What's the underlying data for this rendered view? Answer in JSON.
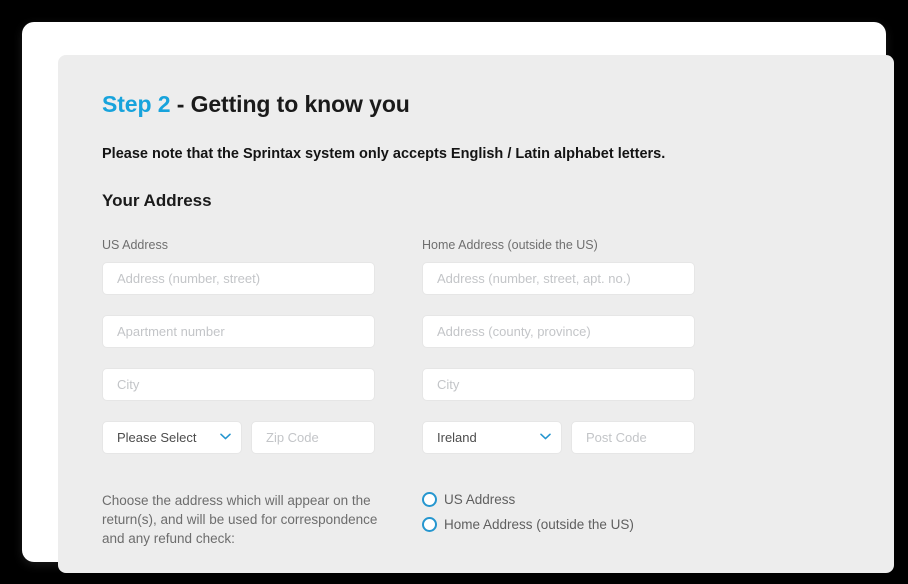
{
  "colors": {
    "accent": "#17a3dc",
    "radio_ring": "#2596cf",
    "panel_bg": "#ededed",
    "frame_bg": "#ffffff",
    "page_bg": "#000000"
  },
  "heading": {
    "step": "Step 2",
    "rest": " - Getting to know you"
  },
  "notice": "Please note that the Sprintax system only accepts English / Latin alphabet letters.",
  "section_title": "Your Address",
  "columns": {
    "us": {
      "label": "US Address",
      "fields": [
        {
          "placeholder": "Address (number, street)",
          "value": ""
        },
        {
          "placeholder": "Apartment number",
          "value": ""
        },
        {
          "placeholder": "City",
          "value": ""
        }
      ],
      "select": {
        "value": "Please Select",
        "icon": "chevron-down-icon"
      },
      "postal": {
        "placeholder": "Zip Code",
        "value": ""
      }
    },
    "home": {
      "label": "Home Address (outside the US)",
      "fields": [
        {
          "placeholder": "Address (number, street, apt. no.)",
          "value": ""
        },
        {
          "placeholder": "Address (county, province)",
          "value": ""
        },
        {
          "placeholder": "City",
          "value": ""
        }
      ],
      "select": {
        "value": "Ireland",
        "icon": "chevron-down-icon"
      },
      "postal": {
        "placeholder": "Post Code",
        "value": ""
      }
    }
  },
  "chooser": {
    "text": "Choose the address which will appear on the return(s), and will be used for correspondence and any refund check:",
    "options": [
      {
        "label": "US Address",
        "selected": false
      },
      {
        "label": "Home Address (outside the US)",
        "selected": false
      }
    ]
  }
}
